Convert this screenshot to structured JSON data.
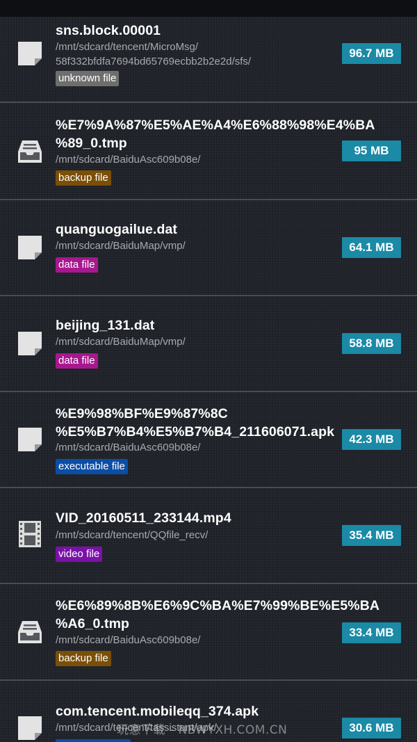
{
  "files": [
    {
      "name": "sns.block.00001",
      "path": "/mnt/sdcard/tencent/MicroMsg/\n58f332bfdfa7694bd65769ecbb2b2e2d/sfs/",
      "type": "unknown file",
      "type_color": "#6e6e6e",
      "size": "96.7 MB",
      "icon": "document-icon"
    },
    {
      "name": "%E7%9A%87%E5%AE%A4%E6%88%98%E4%BA\n%89_0.tmp",
      "path": "/mnt/sdcard/BaiduAsc609b08e/",
      "type": "backup file",
      "type_color": "#7a4f08",
      "size": "95 MB",
      "icon": "archive-tray-icon"
    },
    {
      "name": "quanguogailue.dat",
      "path": "/mnt/sdcard/BaiduMap/vmp/",
      "type": "data file",
      "type_color": "#a8178f",
      "size": "64.1 MB",
      "icon": "document-icon"
    },
    {
      "name": "beijing_131.dat",
      "path": "/mnt/sdcard/BaiduMap/vmp/",
      "type": "data file",
      "type_color": "#a8178f",
      "size": "58.8 MB",
      "icon": "document-icon"
    },
    {
      "name": "%E9%98%BF%E9%87%8C\n%E5%B7%B4%E5%B7%B4_211606071.apk",
      "path": "/mnt/sdcard/BaiduAsc609b08e/",
      "type": "executable file",
      "type_color": "#0b4ea6",
      "size": "42.3 MB",
      "icon": "document-icon"
    },
    {
      "name": "VID_20160511_233144.mp4",
      "path": "/mnt/sdcard/tencent/QQfile_recv/",
      "type": "video file",
      "type_color": "#7a12a8",
      "size": "35.4 MB",
      "icon": "film-icon"
    },
    {
      "name": "%E6%89%8B%E6%9C%BA%E7%99%BE%E5%BA\n%A6_0.tmp",
      "path": "/mnt/sdcard/BaiduAsc609b08e/",
      "type": "backup file",
      "type_color": "#7a4f08",
      "size": "33.4 MB",
      "icon": "archive-tray-icon"
    },
    {
      "name": "com.tencent.mobileqq_374.apk",
      "path": "/mnt/sdcard/tencent/tassistant/apk/",
      "type": "",
      "type_color": "#0b4ea6",
      "size": "30.6 MB",
      "icon": "document-icon"
    }
  ],
  "watermark": "玩意下载 - NBWYXH.COM.CN"
}
